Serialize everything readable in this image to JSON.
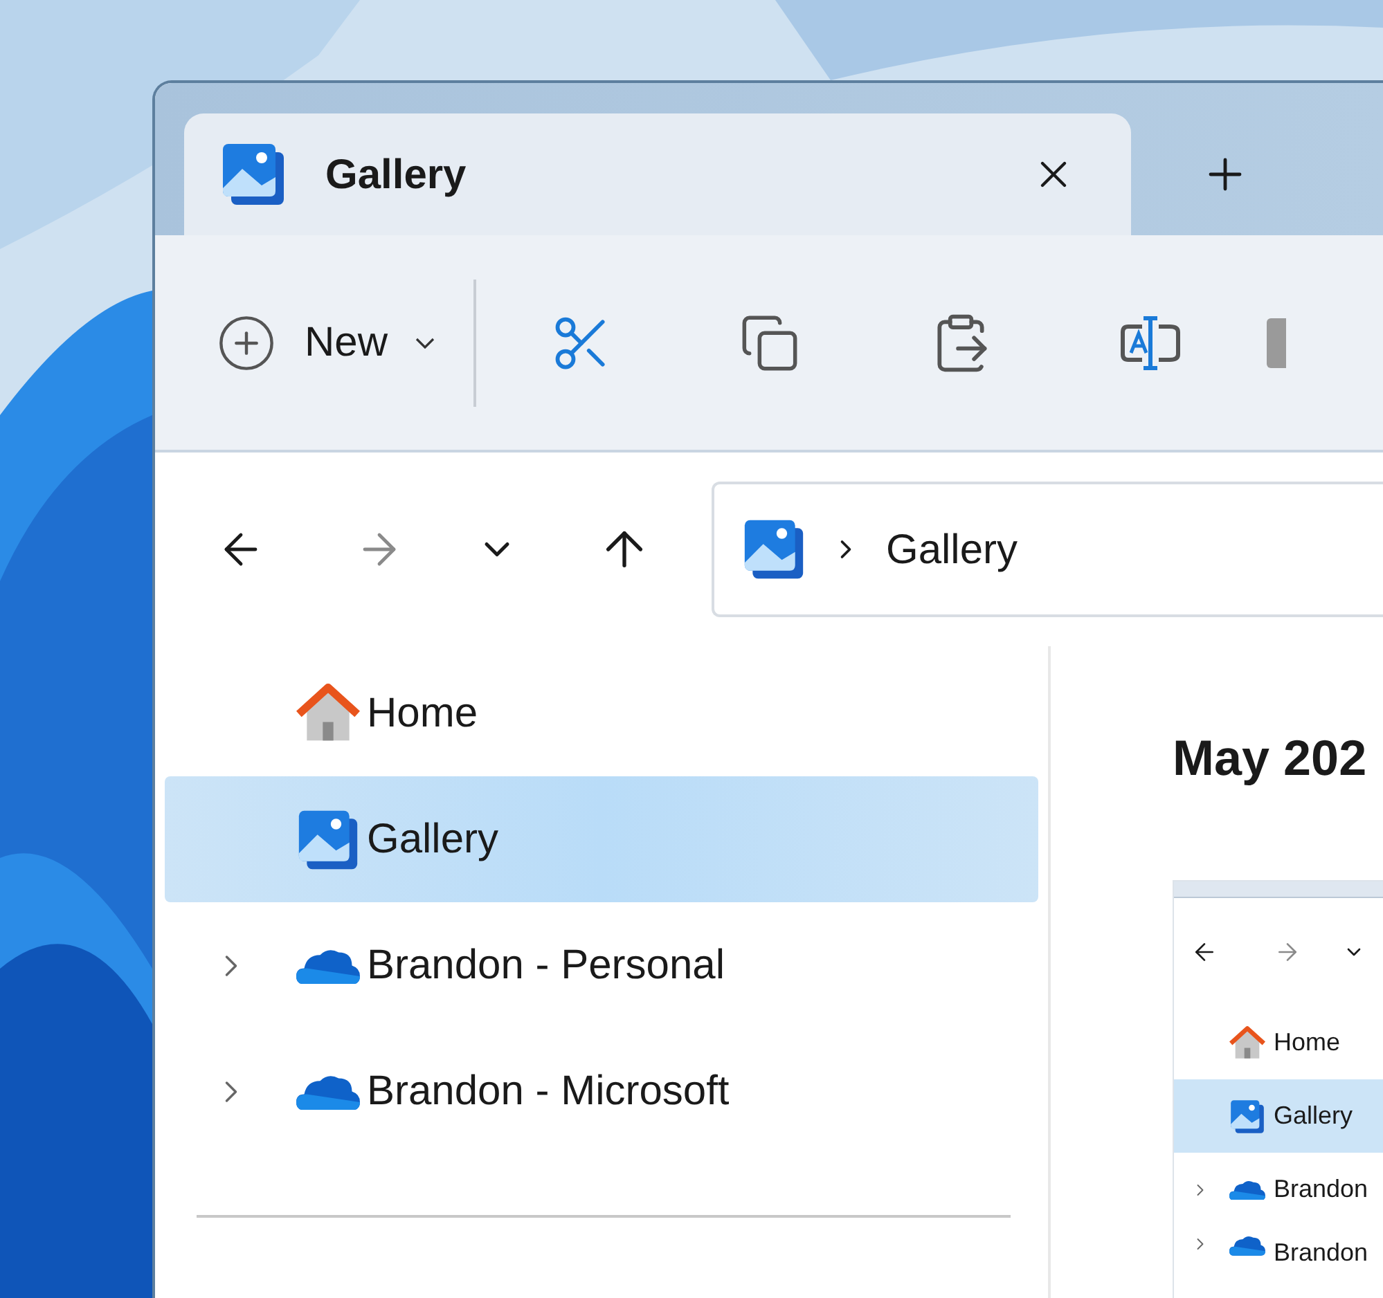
{
  "tab": {
    "title": "Gallery",
    "selected": true
  },
  "toolbar": {
    "new_label": "New"
  },
  "address": {
    "location": "Gallery"
  },
  "sidebar": {
    "items": [
      {
        "label": "Home",
        "kind": "home",
        "selected": false,
        "expandable": false
      },
      {
        "label": "Gallery",
        "kind": "gallery",
        "selected": true,
        "expandable": false
      },
      {
        "label": "Brandon - Personal",
        "kind": "cloud",
        "selected": false,
        "expandable": true
      },
      {
        "label": "Brandon - Microsoft",
        "kind": "cloud",
        "selected": false,
        "expandable": true
      }
    ]
  },
  "content": {
    "heading": "May 202",
    "preview": {
      "items": [
        {
          "label": "Home",
          "kind": "home",
          "selected": false,
          "expandable": false
        },
        {
          "label": "Gallery",
          "kind": "gallery",
          "selected": true,
          "expandable": false
        },
        {
          "label": "Brandon",
          "kind": "cloud",
          "selected": false,
          "expandable": true
        },
        {
          "label": "Brandon",
          "kind": "cloud",
          "selected": false,
          "expandable": true
        }
      ]
    }
  }
}
